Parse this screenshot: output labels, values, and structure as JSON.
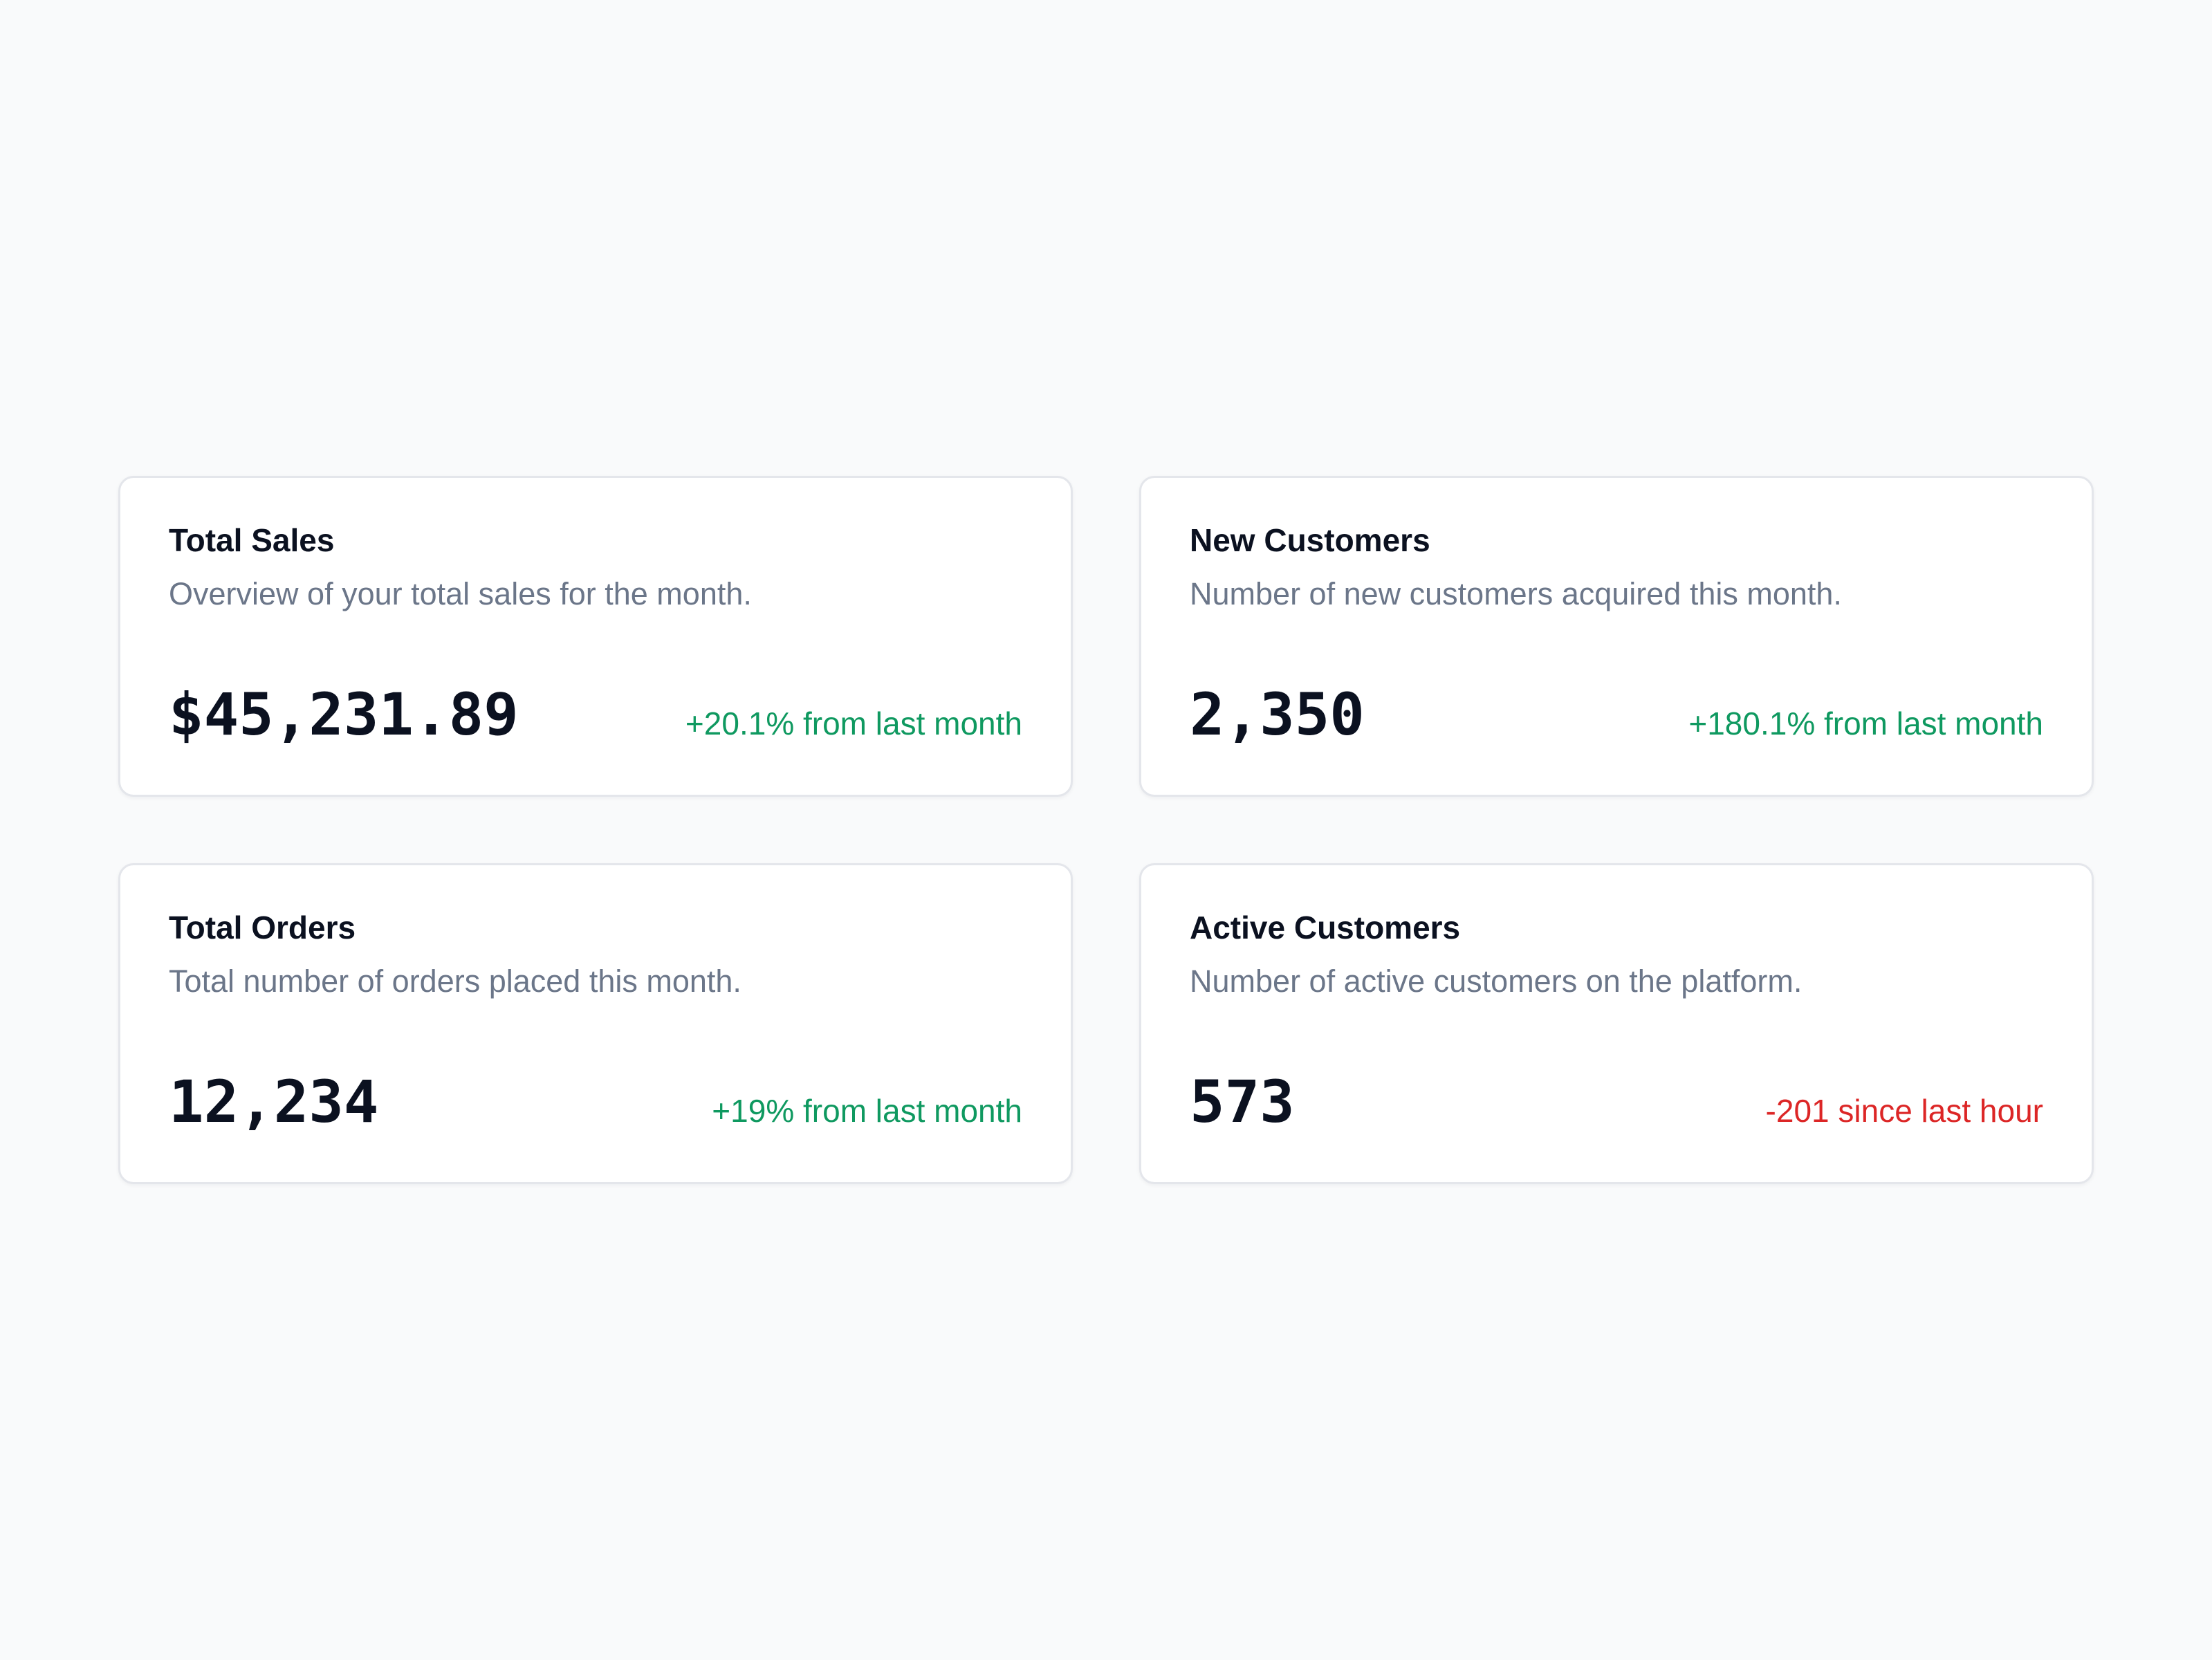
{
  "colors": {
    "page_background": "#f9fafb",
    "card_background": "#ffffff",
    "card_border": "#e4e6eb",
    "title": "#0b1120",
    "description": "#6b7689",
    "positive": "#0f9960",
    "negative": "#dc2626"
  },
  "cards": [
    {
      "title": "Total Sales",
      "description": "Overview of your total sales for the month.",
      "value": "$45,231.89",
      "change": "+20.1% from last month",
      "trend": "up"
    },
    {
      "title": "New Customers",
      "description": "Number of new customers acquired this month.",
      "value": "2,350",
      "change": "+180.1% from last month",
      "trend": "up"
    },
    {
      "title": "Total Orders",
      "description": "Total number of orders placed this month.",
      "value": "12,234",
      "change": "+19% from last month",
      "trend": "up"
    },
    {
      "title": "Active Customers",
      "description": "Number of active customers on the platform.",
      "value": "573",
      "change": "-201 since last hour",
      "trend": "down"
    }
  ]
}
